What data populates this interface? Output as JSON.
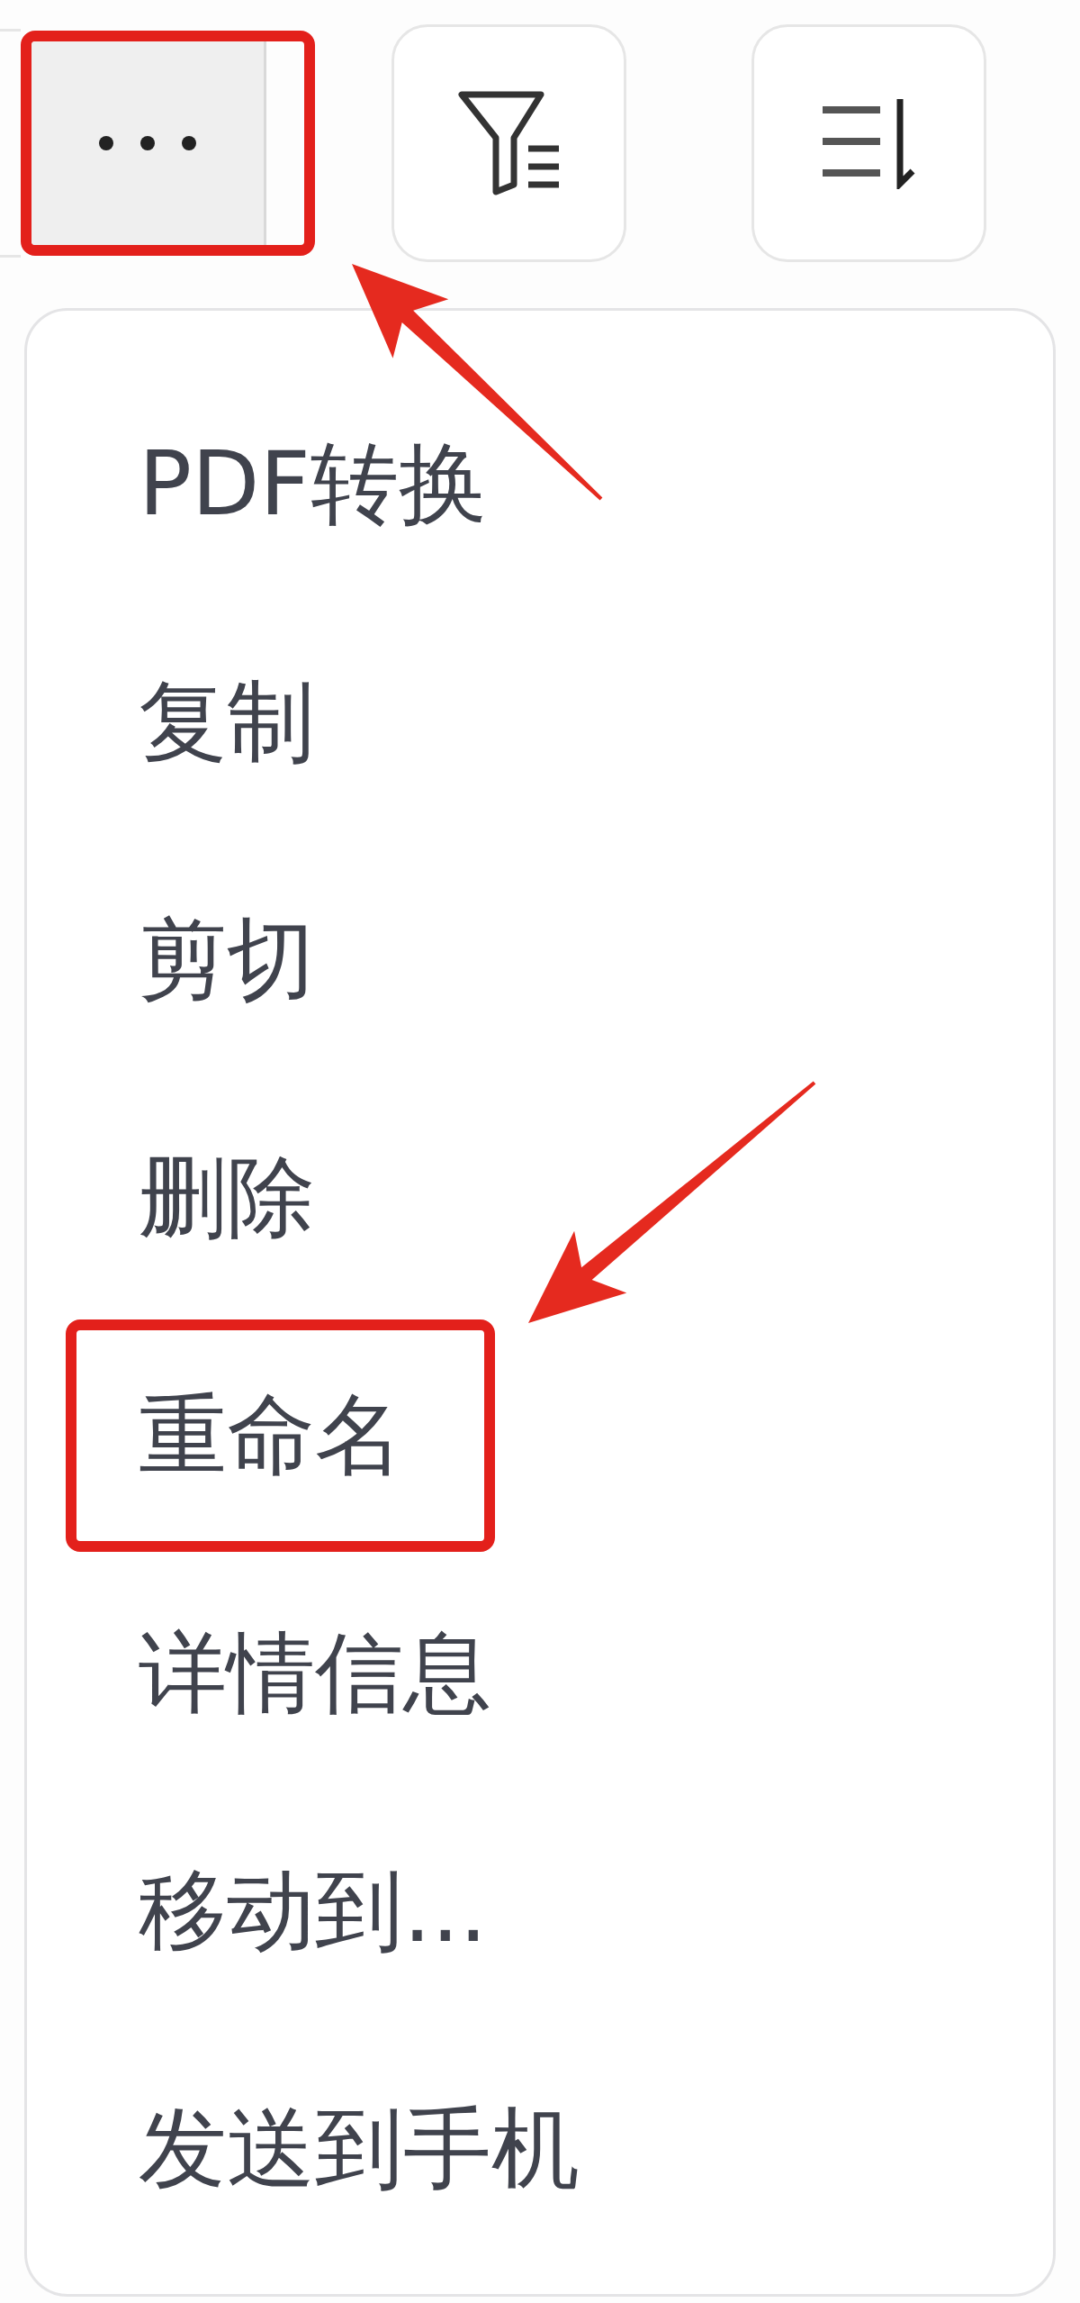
{
  "toolbar": {
    "buttons": [
      {
        "kind": "more",
        "highlighted": true
      },
      {
        "kind": "filter",
        "highlighted": false
      },
      {
        "kind": "sort",
        "highlighted": false
      }
    ]
  },
  "menu": {
    "items": [
      {
        "label": "PDF转换",
        "highlighted": false
      },
      {
        "label": "复制",
        "highlighted": false
      },
      {
        "label": "剪切",
        "highlighted": false
      },
      {
        "label": "删除",
        "highlighted": false
      },
      {
        "label": "重命名",
        "highlighted": true
      },
      {
        "label": "详情信息",
        "highlighted": false
      },
      {
        "label": "移动到...",
        "highlighted": false
      },
      {
        "label": "发送到手机",
        "highlighted": false
      }
    ]
  }
}
